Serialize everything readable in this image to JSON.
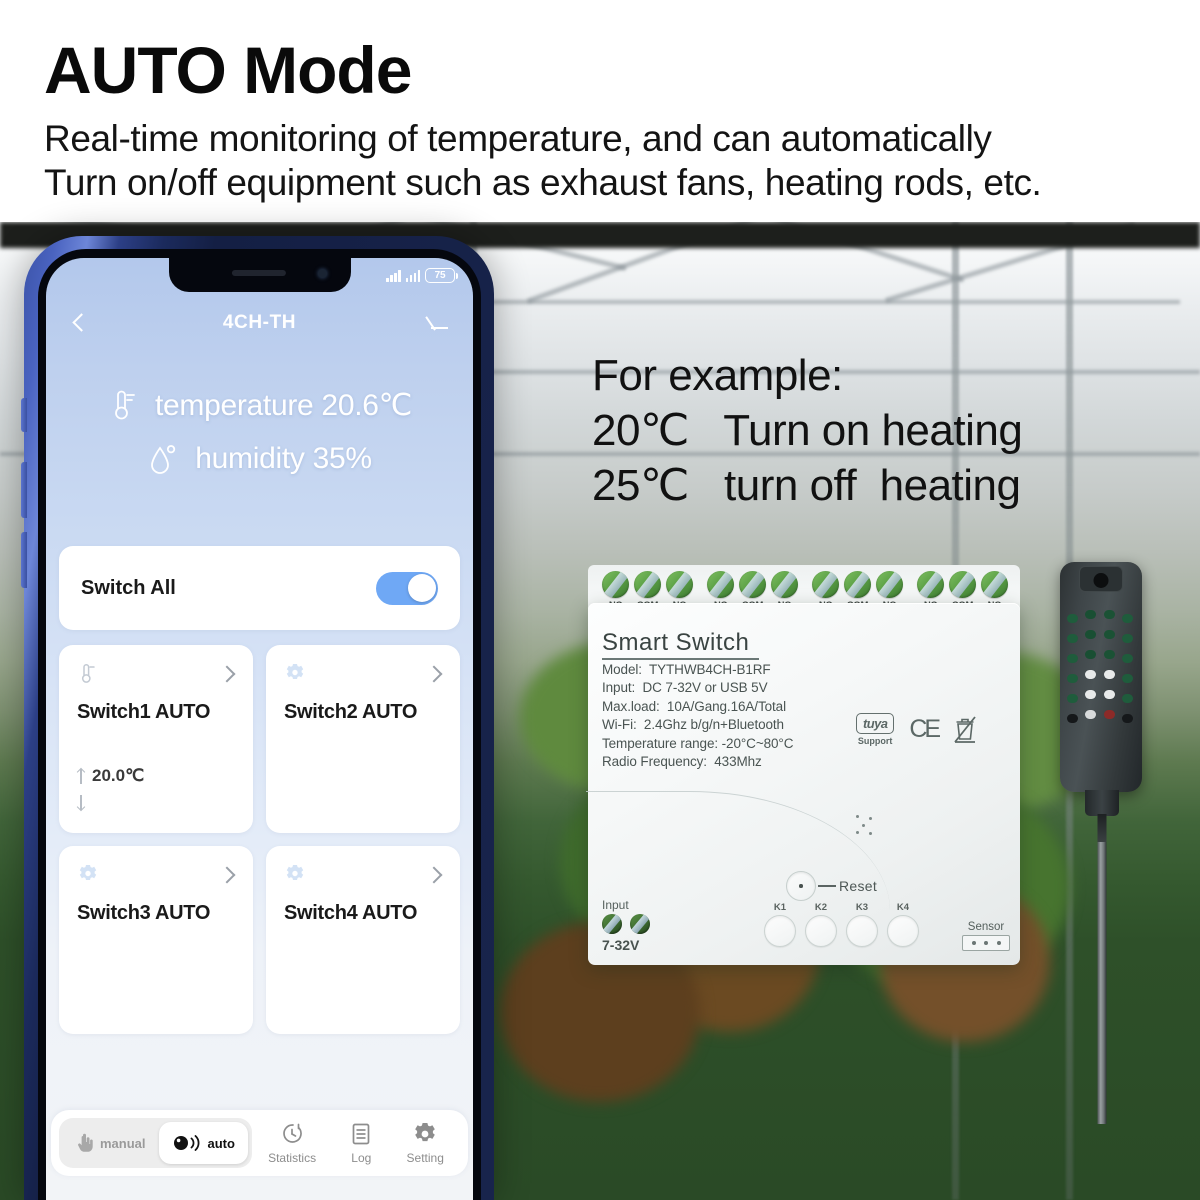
{
  "header": {
    "title": "AUTO Mode",
    "subtitle_lines": [
      "Real-time monitoring of temperature, and can automatically",
      "Turn on/off equipment such as exhaust fans, heating rods, etc."
    ]
  },
  "example": {
    "heading": "For example:",
    "rows": [
      "20℃   Turn on heating",
      "25℃   turn off  heating"
    ]
  },
  "phone": {
    "status_bar": {
      "battery_level": "75",
      "signal_icon_1": "signal-bars-icon",
      "signal_icon_2": "signal-bars-icon",
      "battery_icon": "battery-icon"
    },
    "navbar": {
      "back_icon": "back-chevron-icon",
      "title": "4CH-TH",
      "edit_icon": "edit-pencil-icon"
    },
    "readings": [
      {
        "icon": "thermometer-icon",
        "text": "temperature 20.6℃"
      },
      {
        "icon": "water-drop-icon",
        "text": "humidity 35%"
      }
    ],
    "switch_all": {
      "label": "Switch All",
      "toggle_state": "on",
      "toggle_color": "#6fa8f5"
    },
    "switch_cards": [
      {
        "icon": "thermometer-icon",
        "label": "Switch1 AUTO",
        "chevron": "chevron-right-icon",
        "temp_high": "20.0℃",
        "temp_low": ""
      },
      {
        "icon": "gear-icon",
        "label": "Switch2 AUTO",
        "chevron": "chevron-right-icon",
        "temp_high": "",
        "temp_low": ""
      },
      {
        "icon": "gear-icon",
        "label": "Switch3 AUTO",
        "chevron": "chevron-right-icon",
        "temp_high": "",
        "temp_low": ""
      },
      {
        "icon": "gear-icon",
        "label": "Switch4 AUTO",
        "chevron": "chevron-right-icon",
        "temp_high": "",
        "temp_low": ""
      }
    ],
    "bottom_bar": {
      "mode_manual": {
        "label": "manual",
        "icon": "pointing-hand-icon",
        "selected": false
      },
      "mode_auto": {
        "label": "auto",
        "icon": "auto-sensor-icon",
        "selected": true
      },
      "tabs": [
        {
          "label": "Statistics",
          "icon": "stopwatch-icon"
        },
        {
          "label": "Log",
          "icon": "log-list-icon"
        },
        {
          "label": "Setting",
          "icon": "gear-icon"
        }
      ]
    }
  },
  "device": {
    "title": "Smart  Switch",
    "specs": [
      "Model:  TYTHWB4CH-B1RF",
      "Input:  DC 7-32V or USB 5V",
      "Max.load:  10A/Gang.16A/Total",
      "Wi-Fi:  2.4Ghz b/g/n+Bluetooth",
      "Temperature range: -20°C~80°C",
      "Radio Frequency:  433Mhz"
    ],
    "certs": {
      "tuya_logo": "tuya",
      "tuya_support": "Support",
      "ce_mark": "CE",
      "weee_icon": "weee-crossed-bin-icon"
    },
    "terminal_groups": [
      [
        "NC",
        "COM",
        "NO"
      ],
      [
        "NC",
        "COM",
        "NO"
      ],
      [
        "NC",
        "COM",
        "NO"
      ],
      [
        "NC",
        "COM",
        "NO"
      ]
    ],
    "reset": {
      "label": "Reset",
      "icon": "reset-pinhole-icon"
    },
    "k_buttons": [
      "K1",
      "K2",
      "K3",
      "K4"
    ],
    "input": {
      "label": "Input",
      "voltage": "7-32V"
    },
    "sensor": {
      "label": "Sensor",
      "icon": "sensor-port-icon"
    }
  },
  "probe": {
    "name": "temperature-humidity-sensor-probe"
  }
}
